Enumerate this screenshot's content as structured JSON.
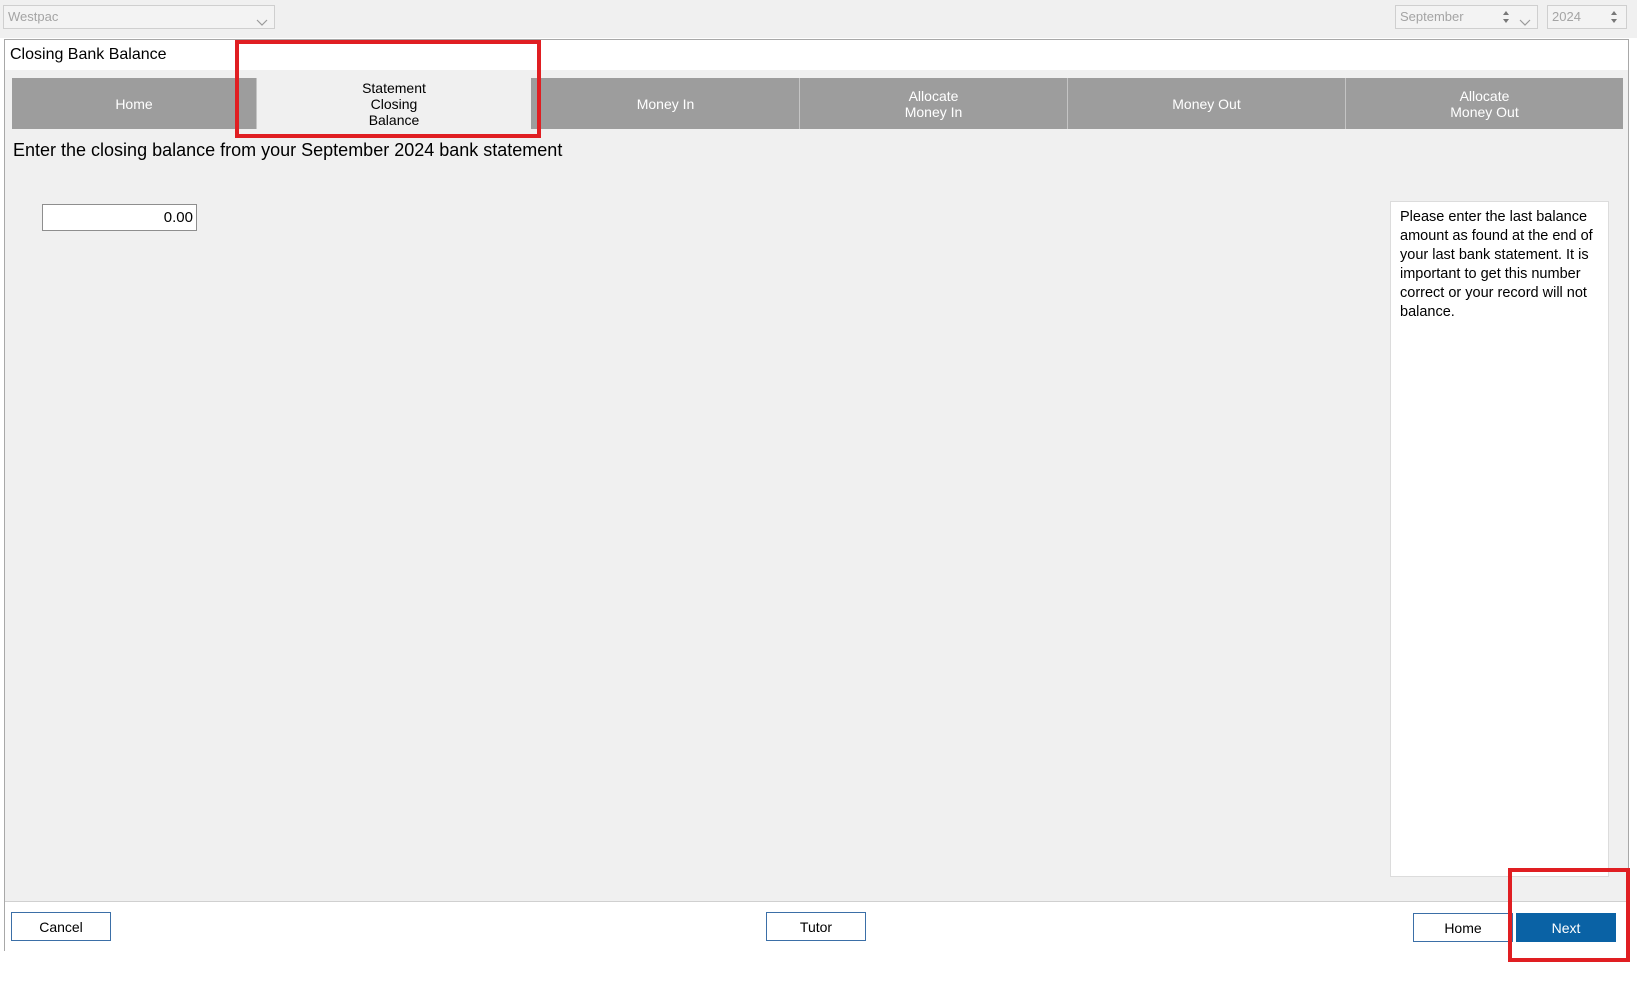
{
  "bank_select": {
    "value": "Westpac"
  },
  "period": {
    "month": "September",
    "year": "2024"
  },
  "panel_title": "Closing Bank Balance",
  "tabs": [
    {
      "label": "Home"
    },
    {
      "label": "Statement\nClosing\nBalance"
    },
    {
      "label": "Money In"
    },
    {
      "label": "Allocate\nMoney In"
    },
    {
      "label": "Money Out"
    },
    {
      "label": "Allocate\nMoney Out"
    }
  ],
  "active_tab": "Statement Closing Balance",
  "instruction": "Enter the closing balance from your September 2024 bank statement",
  "closing_balance": {
    "value": "0.00"
  },
  "help_text": "Please enter the last balance amount as found at the end of your last bank statement. It is important to get this number correct or your record will not balance.",
  "footer": {
    "cancel_label": "Cancel",
    "tutor_label": "Tutor",
    "home_label": "Home",
    "next_label": "Next"
  },
  "colors": {
    "accent": "#0a62a5",
    "tab_inactive": "#9d9d9d",
    "highlight": "#e01e22"
  }
}
